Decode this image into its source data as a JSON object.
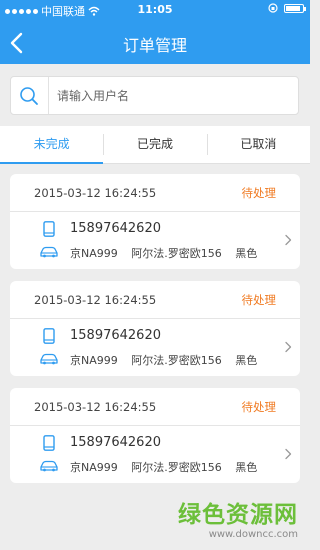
{
  "status_bar": {
    "carrier": "中国联通",
    "time": "11:05",
    "battery_level": 0.85
  },
  "header": {
    "title": "订单管理",
    "back_icon": "chevron-left-icon"
  },
  "search": {
    "placeholder": "请输入用户名",
    "value": "",
    "icon": "search-icon"
  },
  "tabs": [
    {
      "label": "未完成",
      "active": true
    },
    {
      "label": "已完成",
      "active": false
    },
    {
      "label": "已取消",
      "active": false
    }
  ],
  "orders": [
    {
      "datetime": "2015-03-12  16:24:55",
      "status": "待处理",
      "phone": "15897642620",
      "plate": "京NA999",
      "model": "阿尔法.罗密欧156",
      "color": "黑色"
    },
    {
      "datetime": "2015-03-12  16:24:55",
      "status": "待处理",
      "phone": "15897642620",
      "plate": "京NA999",
      "model": "阿尔法.罗密欧156",
      "color": "黑色"
    },
    {
      "datetime": "2015-03-12  16:24:55",
      "status": "待处理",
      "phone": "15897642620",
      "plate": "京NA999",
      "model": "阿尔法.罗密欧156",
      "color": "黑色"
    }
  ],
  "watermark": {
    "name": "绿色资源网",
    "url": "www.downcc.com"
  },
  "colors": {
    "accent": "#2f9cf0",
    "status_pending": "#f07b23",
    "watermark": "#6cbf3a"
  }
}
